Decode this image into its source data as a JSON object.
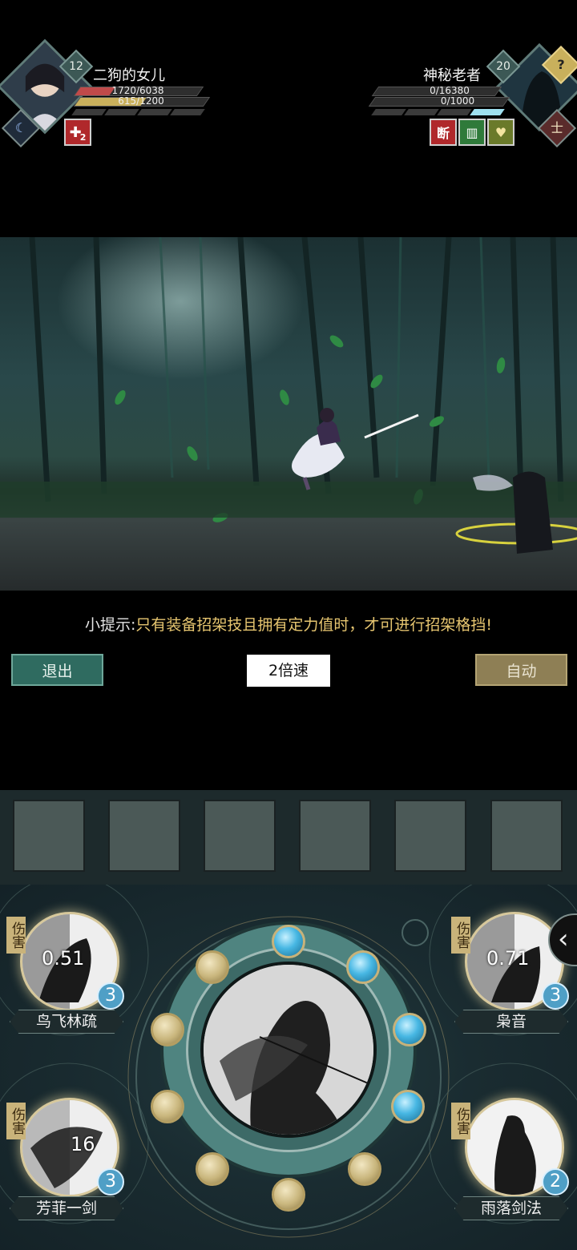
{
  "player": {
    "name": "二狗的女儿",
    "level": "12",
    "hp_text": "1720/6038",
    "mp_text": "615/1200",
    "hp_fraction": 0.285,
    "mp_fraction": 0.512,
    "buff_count": "2",
    "class_icon": "crescent-moon-icon"
  },
  "enemy": {
    "name": "神秘老者",
    "level": "20",
    "hp_text": "0/16380",
    "mp_text": "0/1000",
    "unknown_mark": "?",
    "class_glyph": "士",
    "status_icons": [
      "断",
      "book-icon",
      "broken-heart-icon"
    ],
    "break_label": "断"
  },
  "hint": {
    "prefix": "小提示:",
    "message": "只有装备招架技且拥有定力值时，才可进行招架格挡!"
  },
  "controls": {
    "exit": "退出",
    "speed": "2倍速",
    "auto": "自动"
  },
  "slots": 6,
  "skills": [
    {
      "name": "鸟飞林疏",
      "tag": "伤害",
      "cooldown": "0.51",
      "charges": "3"
    },
    {
      "name": "枭音",
      "tag": "伤害",
      "cooldown": "0.71",
      "charges": "3"
    },
    {
      "name": "芳菲一剑",
      "tag": "伤害",
      "cooldown": "16",
      "charges": "3"
    },
    {
      "name": "雨落剑法",
      "tag": "伤害",
      "cooldown": "",
      "charges": "2"
    }
  ],
  "wheel": {
    "orbs_filled": 5,
    "orbs_total": 12
  },
  "collapse_arrow": "‹",
  "colors": {
    "hp": "#c04a4a",
    "mp": "#c9b05c",
    "tip": "#e7c670",
    "exit_bg": "#2f6b60",
    "auto_bg": "#8e7f55"
  }
}
